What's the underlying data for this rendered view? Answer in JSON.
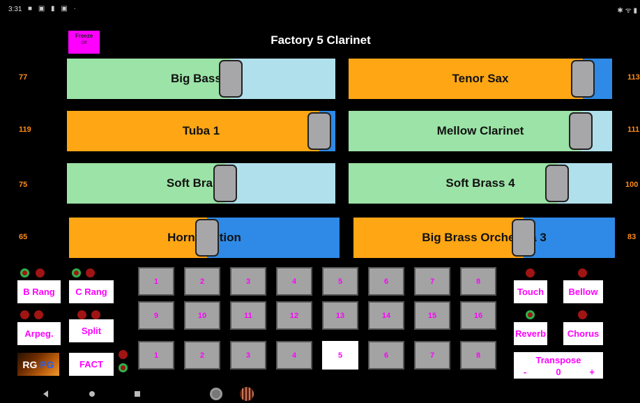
{
  "status_bar": {
    "time": "3:31",
    "left_icons": "■ ▣ ▮ ▣ ·",
    "right_icons": "✱ ᯤ ▮"
  },
  "freeze": {
    "label": "Freeze",
    "sub": "Off"
  },
  "preset_title": "Factory 5 Clarinet",
  "sliders": [
    {
      "name": "Big Bass 2",
      "level": "77",
      "position": 0.61,
      "track_color": "#b0e0ec",
      "fill_color": "#9be3a6"
    },
    {
      "name": "Tenor Sax",
      "level": "113",
      "position": 0.89,
      "track_color": "#2e8ae6",
      "fill_color": "#ffa614"
    },
    {
      "name": "Tuba 1",
      "level": "119",
      "position": 0.94,
      "track_color": "#2e8ae6",
      "fill_color": "#ffa614"
    },
    {
      "name": "Mellow Clarinet",
      "level": "111",
      "position": 0.88,
      "track_color": "#b0e0ec",
      "fill_color": "#9be3a6"
    },
    {
      "name": "Soft Brass 1",
      "level": "75",
      "position": 0.59,
      "track_color": "#b0e0ec",
      "fill_color": "#9be3a6"
    },
    {
      "name": "Soft Brass 4",
      "level": "100",
      "position": 0.79,
      "track_color": "#b0e0ec",
      "fill_color": "#9be3a6"
    },
    {
      "name": "Horn Section",
      "level": "65",
      "position": 0.51,
      "track_color": "#2e8ae6",
      "fill_color": "#ffa614"
    },
    {
      "name": "Big Brass Orchestra 3",
      "level": "83",
      "position": 0.65,
      "track_color": "#2e8ae6",
      "fill_color": "#ffa614"
    }
  ],
  "left_buttons": {
    "b_rang": "B Rang",
    "c_rang": "C Rang",
    "arpeg": "Arpeg.",
    "split": "Split",
    "fact": "FACT",
    "rg": "RG",
    "pg": "PG"
  },
  "right_buttons": {
    "touch": "Touch",
    "bellow": "Bellow",
    "reverb": "Reverb",
    "chorus": "Chorus"
  },
  "transpose": {
    "label": "Transpose",
    "minus": "-",
    "value": "0",
    "plus": "+"
  },
  "pads_row1": [
    "1",
    "2",
    "3",
    "4",
    "5",
    "6",
    "7",
    "8"
  ],
  "pads_row2": [
    "9",
    "10",
    "11",
    "12",
    "13",
    "14",
    "15",
    "16"
  ],
  "pads_row3": [
    "1",
    "2",
    "3",
    "4",
    "5",
    "6",
    "7",
    "8"
  ],
  "selected_pad_row3": "5",
  "colors": {
    "magenta": "#ff00ff",
    "orange_label": "#ff8c1a",
    "led_off": "#a01414",
    "led_on": "#2bb34a"
  }
}
